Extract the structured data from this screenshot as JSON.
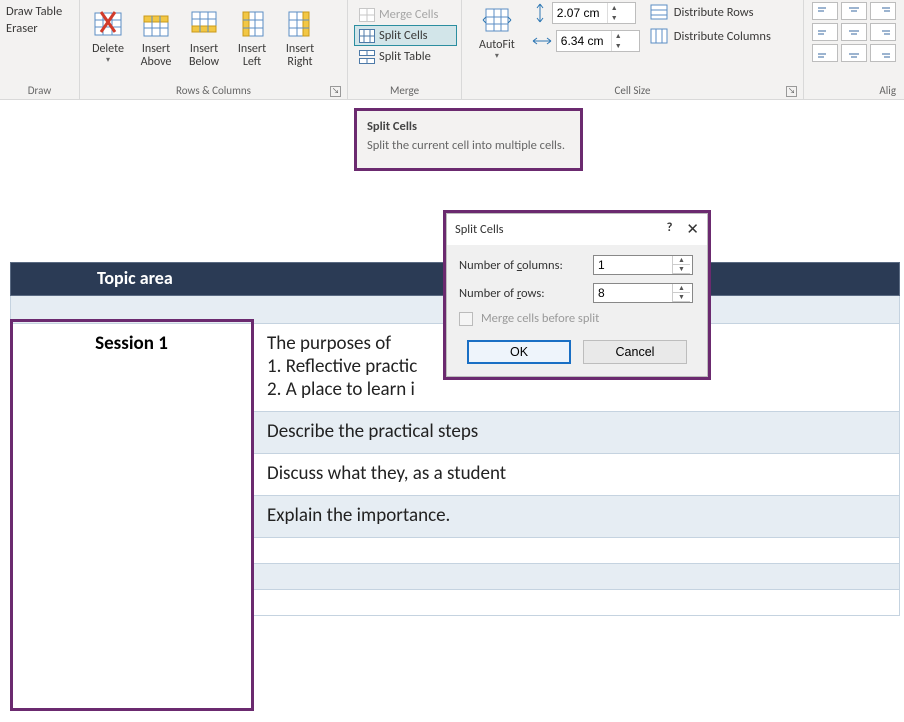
{
  "ribbon": {
    "draw": {
      "label": "Draw",
      "draw_table": "Draw Table",
      "eraser": "Eraser"
    },
    "rows_cols": {
      "label": "Rows & Columns",
      "delete": "Delete",
      "insert_above": "Insert Above",
      "insert_below": "Insert Below",
      "insert_left": "Insert Left",
      "insert_right": "Insert Right"
    },
    "merge": {
      "label": "Merge",
      "merge_cells": "Merge Cells",
      "split_cells": "Split Cells",
      "split_table": "Split Table"
    },
    "cell_size": {
      "label": "Cell Size",
      "autofit": "AutoFit",
      "height_value": "2.07 cm",
      "width_value": "6.34 cm",
      "distribute_rows": "Distribute Rows",
      "distribute_columns": "Distribute Columns"
    },
    "alignment": {
      "label": "Alig"
    }
  },
  "tooltip": {
    "title": "Split Cells",
    "body": "Split the current cell into multiple cells."
  },
  "table": {
    "header": "Topic area",
    "session_label": "Session 1",
    "rows": [
      "The purposes of\n1.  Reflective practic\n2.  A place to learn i",
      "Describe the practical steps",
      "Discuss what they, as a student",
      "Explain the importance.",
      "",
      "",
      ""
    ]
  },
  "dialog": {
    "title": "Split Cells",
    "cols_label_pre": "Number of ",
    "cols_label_u": "c",
    "cols_label_post": "olumns:",
    "rows_label_pre": "Number of ",
    "rows_label_u": "r",
    "rows_label_post": "ows:",
    "cols_value": "1",
    "rows_value": "8",
    "merge_before": "Merge cells before split",
    "ok": "OK",
    "cancel": "Cancel"
  }
}
